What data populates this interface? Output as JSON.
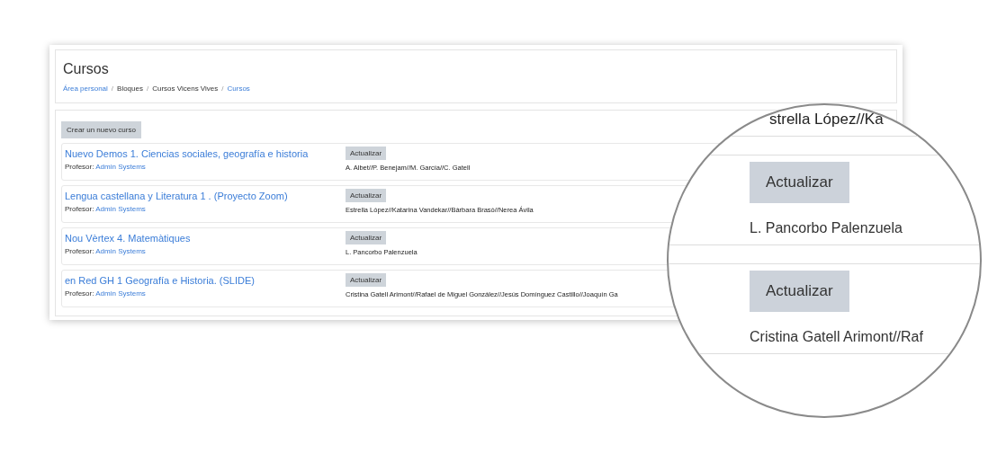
{
  "page": {
    "title": "Cursos",
    "breadcrumb_separator": "/",
    "breadcrumb": [
      {
        "label": "Área personal",
        "link": true
      },
      {
        "label": "Bloques",
        "link": false
      },
      {
        "label": "Cursos Vicens Vives",
        "link": false
      },
      {
        "label": "Cursos",
        "link": true
      }
    ]
  },
  "create_button": "Crear un nuevo curso",
  "courses": [
    {
      "title": "Nuevo Demos 1. Ciencias sociales, geografía e historia",
      "teacher_label": "Profesor:",
      "teacher": "Admin Systems",
      "button": "Actualizar",
      "authors": "A. Albet//P. Benejam//M. García//C. Gatell"
    },
    {
      "title": "Lengua castellana y Literatura 1 . (Proyecto Zoom)",
      "teacher_label": "Profesor:",
      "teacher": "Admin Systems",
      "button": "Actualizar",
      "authors": "Estrella López//Katarina Vandekar//Bárbara Brasó//Nerea Ávila"
    },
    {
      "title": "Nou Vèrtex 4. Matemàtiques",
      "teacher_label": "Profesor:",
      "teacher": "Admin Systems",
      "button": "Actualizar",
      "authors": "L. Pancorbo Palenzuela"
    },
    {
      "title": "en Red GH 1 Geografía e Historia. (SLIDE)",
      "teacher_label": "Profesor:",
      "teacher": "Admin Systems",
      "button": "Actualizar",
      "authors": "Cristina Gatell Arimont//Rafael de Miguel González//Jesús Domínguez Castillo//Joaquín Ga"
    }
  ],
  "magnifier": {
    "top_text": "strella López//Ka",
    "items": [
      {
        "button": "Actualizar",
        "authors": "L. Pancorbo Palenzuela"
      },
      {
        "button": "Actualizar",
        "authors": "Cristina Gatell Arimont//Raf"
      }
    ]
  }
}
